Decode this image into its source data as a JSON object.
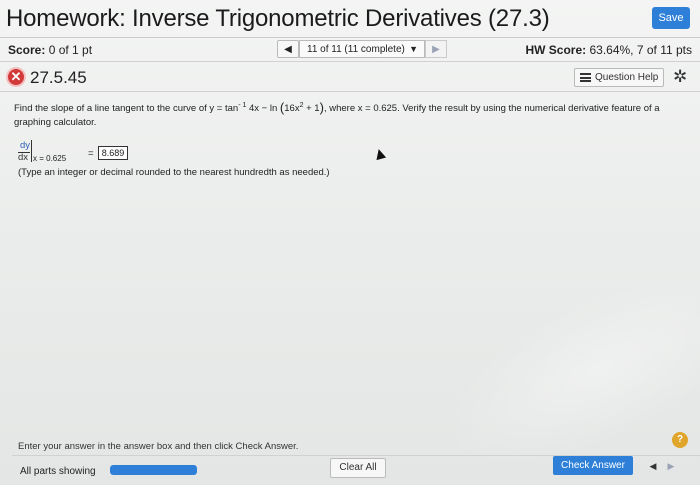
{
  "header": {
    "title": "Homework: Inverse Trigonometric Derivatives (27.3)",
    "save_label": "Save"
  },
  "scorebar": {
    "score_label": "Score:",
    "score_value": "0 of 1 pt",
    "nav_prev_icon": "triangle-left-icon",
    "nav_select_value": "11 of 11 (11 complete)",
    "nav_next_icon": "triangle-right-icon",
    "hw_score_label": "HW Score:",
    "hw_score_value": "63.64%, 7 of 11 pts"
  },
  "question_bar": {
    "status_icon": "incorrect-x-icon",
    "question_number": "27.5.45",
    "question_help_label": "Question Help",
    "settings_icon": "gear-icon"
  },
  "question": {
    "text_prefix": "Find the slope of a line tangent to the curve of y = tan",
    "exp_neg1": "- 1",
    "text_func": "4x − ln",
    "inner_a": "16x",
    "exp_2": "2",
    "inner_b": " + 1",
    "text_suffix": ", where x = 0.625. Verify the result by using the numerical derivative feature of a graphing calculator."
  },
  "answer": {
    "dy": "dy",
    "dx": "dx",
    "eval_at": "x = 0.625",
    "equals": "=",
    "value": "8.689",
    "hint": "(Type an integer or decimal rounded to the nearest hundredth as needed.)"
  },
  "footer": {
    "instruction": "Enter your answer in the answer box and then click Check Answer.",
    "help_icon": "?",
    "all_parts_label": "All parts showing",
    "progress_fraction": 1.0,
    "clear_all_label": "Clear All",
    "check_answer_label": "Check Answer",
    "prev_part_icon": "triangle-left-icon",
    "next_part_icon": "triangle-right-icon"
  },
  "colors": {
    "accent": "#2d7fd8",
    "error": "#d23a3a",
    "help": "#e0a52b"
  }
}
